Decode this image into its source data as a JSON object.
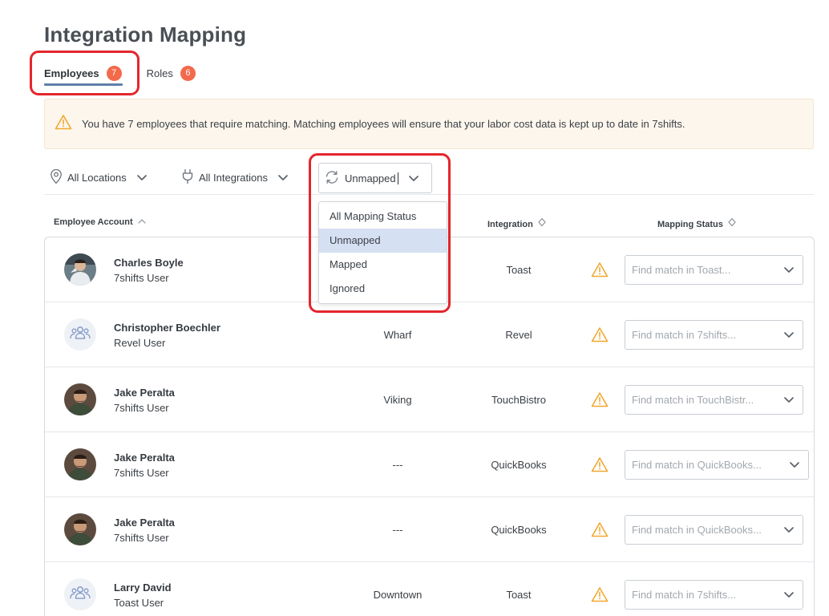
{
  "page": {
    "title": "Integration Mapping"
  },
  "tabs": [
    {
      "label": "Employees",
      "count": "7",
      "active": true
    },
    {
      "label": "Roles",
      "count": "6",
      "active": false
    }
  ],
  "alert": {
    "text": "You have 7 employees that require matching. Matching employees will ensure that your labor cost data is kept up to date in 7shifts."
  },
  "filters": {
    "locations": "All Locations",
    "integrations": "All Integrations",
    "status": "Unmapped"
  },
  "status_dropdown": {
    "options": [
      "All Mapping Status",
      "Unmapped",
      "Mapped",
      "Ignored"
    ],
    "selected": "Unmapped"
  },
  "columns": {
    "employee_account": "Employee Account",
    "integration": "Integration",
    "mapping_status": "Mapping Status"
  },
  "rows": [
    {
      "name": "Charles Boyle",
      "type": "7shifts User",
      "location": "",
      "integration": "Toast",
      "match_placeholder": "Find match in Toast...",
      "avatar": "photo"
    },
    {
      "name": "Christopher Boechler",
      "type": "Revel User",
      "location": "Wharf",
      "integration": "Revel",
      "match_placeholder": "Find match in 7shifts...",
      "avatar": "group-icon"
    },
    {
      "name": "Jake Peralta",
      "type": "7shifts User",
      "location": "Viking",
      "integration": "TouchBistro",
      "match_placeholder": "Find match in TouchBistr...",
      "avatar": "photo"
    },
    {
      "name": "Jake Peralta",
      "type": "7shifts User",
      "location": "---",
      "integration": "QuickBooks",
      "match_placeholder": "Find match in QuickBooks...",
      "avatar": "photo"
    },
    {
      "name": "Jake Peralta",
      "type": "7shifts User",
      "location": "---",
      "integration": "QuickBooks",
      "match_placeholder": "Find match in QuickBooks...",
      "avatar": "photo"
    },
    {
      "name": "Larry David",
      "type": "Toast User",
      "location": "Downtown",
      "integration": "Toast",
      "match_placeholder": "Find match in 7shifts...",
      "avatar": "group-icon"
    }
  ],
  "colors": {
    "badge": "#f26a4b",
    "tab_underline": "#5f7fa8",
    "annotation": "#e4262d",
    "alert_bg": "#fdf6ec",
    "warning": "#f0a830",
    "dropdown_selected": "#d6e0f3"
  }
}
